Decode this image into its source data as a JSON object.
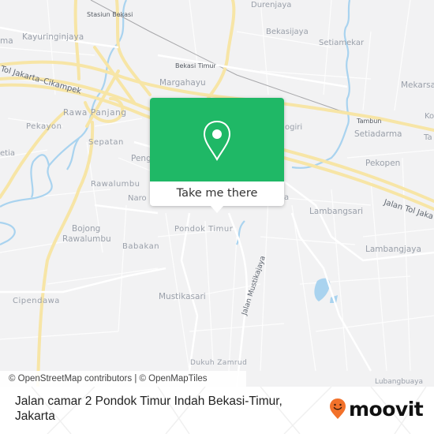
{
  "map": {
    "place_labels": [
      {
        "id": "stasiun-bekasi",
        "text": "Stasiun Bekasi",
        "kind": "small"
      },
      {
        "id": "durenjaya",
        "text": "Durenjaya",
        "kind": "place"
      },
      {
        "id": "kayuringinjaya",
        "text": "Kayuringinjaya",
        "kind": "place"
      },
      {
        "id": "bekasijaya",
        "text": "Bekasijaya",
        "kind": "place"
      },
      {
        "id": "setiamekar",
        "text": "Setiamekar",
        "kind": "place"
      },
      {
        "id": "bekasi-timur",
        "text": "Bekasi Timur",
        "kind": "small"
      },
      {
        "id": "margahayu",
        "text": "Margahayu",
        "kind": "place"
      },
      {
        "id": "mekarsari",
        "text": "Mekarsa",
        "kind": "place"
      },
      {
        "id": "rawa-panjang",
        "text": "Rawa Panjang",
        "kind": "place"
      },
      {
        "id": "tambun",
        "text": "Tambun",
        "kind": "small"
      },
      {
        "id": "pekayon",
        "text": "Pekayon",
        "kind": "place"
      },
      {
        "id": "bogiri",
        "text": "ogiri",
        "kind": "place"
      },
      {
        "id": "setiadarma",
        "text": "Setiadarma",
        "kind": "place"
      },
      {
        "id": "ko",
        "text": "Ko",
        "kind": "place"
      },
      {
        "id": "ta",
        "text": "Ta",
        "kind": "place"
      },
      {
        "id": "setia",
        "text": "etia",
        "kind": "place"
      },
      {
        "id": "sepatan",
        "text": "Sepatan",
        "kind": "place"
      },
      {
        "id": "pengasinan",
        "text": "Peng",
        "kind": "place"
      },
      {
        "id": "pekopen",
        "text": "Pekopen",
        "kind": "place"
      },
      {
        "id": "rawalumbu",
        "text": "Rawalumbu",
        "kind": "place"
      },
      {
        "id": "narogong",
        "text": "Naro",
        "kind": "place"
      },
      {
        "id": "a-partial",
        "text": "a",
        "kind": "place"
      },
      {
        "id": "lambangsari",
        "text": "Lambangsari",
        "kind": "place"
      },
      {
        "id": "pondok-timur",
        "text": "Pondok Timur",
        "kind": "place"
      },
      {
        "id": "bojong-rawalumbu-1",
        "text": "Bojong",
        "kind": "place"
      },
      {
        "id": "bojong-rawalumbu-2",
        "text": "Rawalumbu",
        "kind": "place"
      },
      {
        "id": "babakan",
        "text": "Babakan",
        "kind": "place"
      },
      {
        "id": "lambangjaya",
        "text": "Lambangjaya",
        "kind": "place"
      },
      {
        "id": "mustikasari",
        "text": "Mustikasari",
        "kind": "place"
      },
      {
        "id": "cipendawa",
        "text": "Cipendawa",
        "kind": "place"
      },
      {
        "id": "dukuh-zamrud",
        "text": "Dukuh Zamrud",
        "kind": "place"
      },
      {
        "id": "lubangbuaya",
        "text": "Lubangbuaya",
        "kind": "place"
      },
      {
        "id": "ma-partial",
        "text": "ma",
        "kind": "place"
      }
    ],
    "road_labels": [
      {
        "id": "tol-jakarta-cikampek-west",
        "text": "Tol Jakarta–Cikampek"
      },
      {
        "id": "jalan-tol-jakarta-east",
        "text": "Jalan Tol Jaka"
      },
      {
        "id": "jalan-mustikajaya",
        "text": "Jalan Mustikajaya"
      }
    ],
    "attribution": "© OpenStreetMap contributors | © OpenMapTiles"
  },
  "popup": {
    "icon": "location-pin-icon",
    "button_label": "Take me there",
    "accent_color": "#1fb866"
  },
  "footer": {
    "address": "Jalan camar 2 Pondok Timur Indah Bekasi-Timur, Jakarta",
    "brand_name": "moovit",
    "brand_icon": "moovit-pin-smile-icon",
    "brand_color": "#f2712a"
  }
}
